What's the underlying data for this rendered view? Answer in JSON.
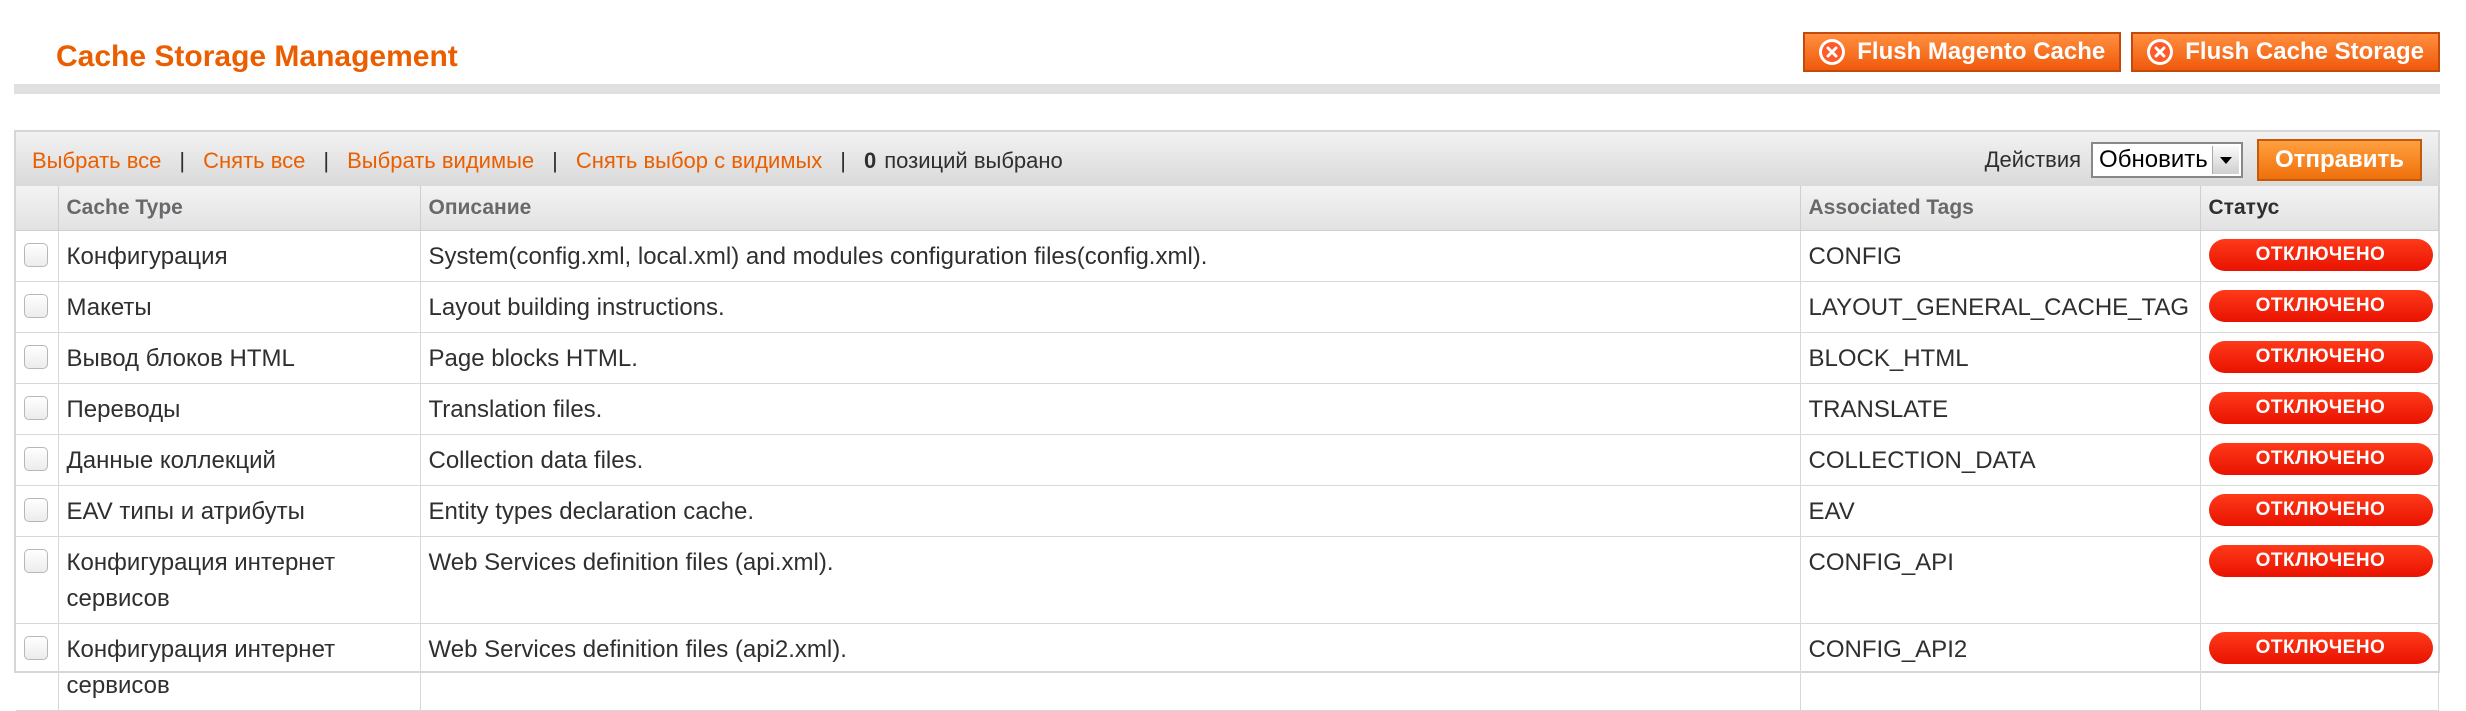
{
  "page": {
    "title": "Cache Storage Management"
  },
  "top_buttons": {
    "flush_magento": "Flush Magento Cache",
    "flush_storage": "Flush Cache Storage"
  },
  "massaction": {
    "select_all": "Выбрать все",
    "unselect_all": "Снять все",
    "select_visible": "Выбрать видимые",
    "unselect_visible": "Снять выбор с видимых",
    "selected_count": "0",
    "selected_label": "позиций выбрано",
    "actions_label": "Действия",
    "action_selected": "Обновить",
    "submit_label": "Отправить",
    "separator": "|"
  },
  "columns": {
    "cache_type": "Cache Type",
    "description": "Описание",
    "tags": "Associated Tags",
    "status": "Статус"
  },
  "rows": [
    {
      "type": "Конфигурация",
      "description": "System(config.xml, local.xml) and modules configuration files(config.xml).",
      "tags": "CONFIG",
      "status": "ОТКЛЮЧЕНО"
    },
    {
      "type": "Макеты",
      "description": "Layout building instructions.",
      "tags": "LAYOUT_GENERAL_CACHE_TAG",
      "status": "ОТКЛЮЧЕНО"
    },
    {
      "type": "Вывод блоков HTML",
      "description": "Page blocks HTML.",
      "tags": "BLOCK_HTML",
      "status": "ОТКЛЮЧЕНО"
    },
    {
      "type": "Переводы",
      "description": "Translation files.",
      "tags": "TRANSLATE",
      "status": "ОТКЛЮЧЕНО"
    },
    {
      "type": "Данные коллекций",
      "description": "Collection data files.",
      "tags": "COLLECTION_DATA",
      "status": "ОТКЛЮЧЕНО"
    },
    {
      "type": "EAV типы и атрибуты",
      "description": "Entity types declaration cache.",
      "tags": "EAV",
      "status": "ОТКЛЮЧЕНО"
    },
    {
      "type": "Конфигурация интернет сервисов",
      "description": "Web Services definition files (api.xml).",
      "tags": "CONFIG_API",
      "status": "ОТКЛЮЧЕНО"
    },
    {
      "type": "Конфигурация интернет сервисов",
      "description": "Web Services definition files (api2.xml).",
      "tags": "CONFIG_API2",
      "status": "ОТКЛЮЧЕНО"
    }
  ],
  "colors": {
    "accent": "#eb5e00",
    "status_disabled": "#e81200"
  },
  "icons": {
    "flush_button_icon": "x-circle-icon",
    "select_arrow": "chevron-down-icon"
  }
}
